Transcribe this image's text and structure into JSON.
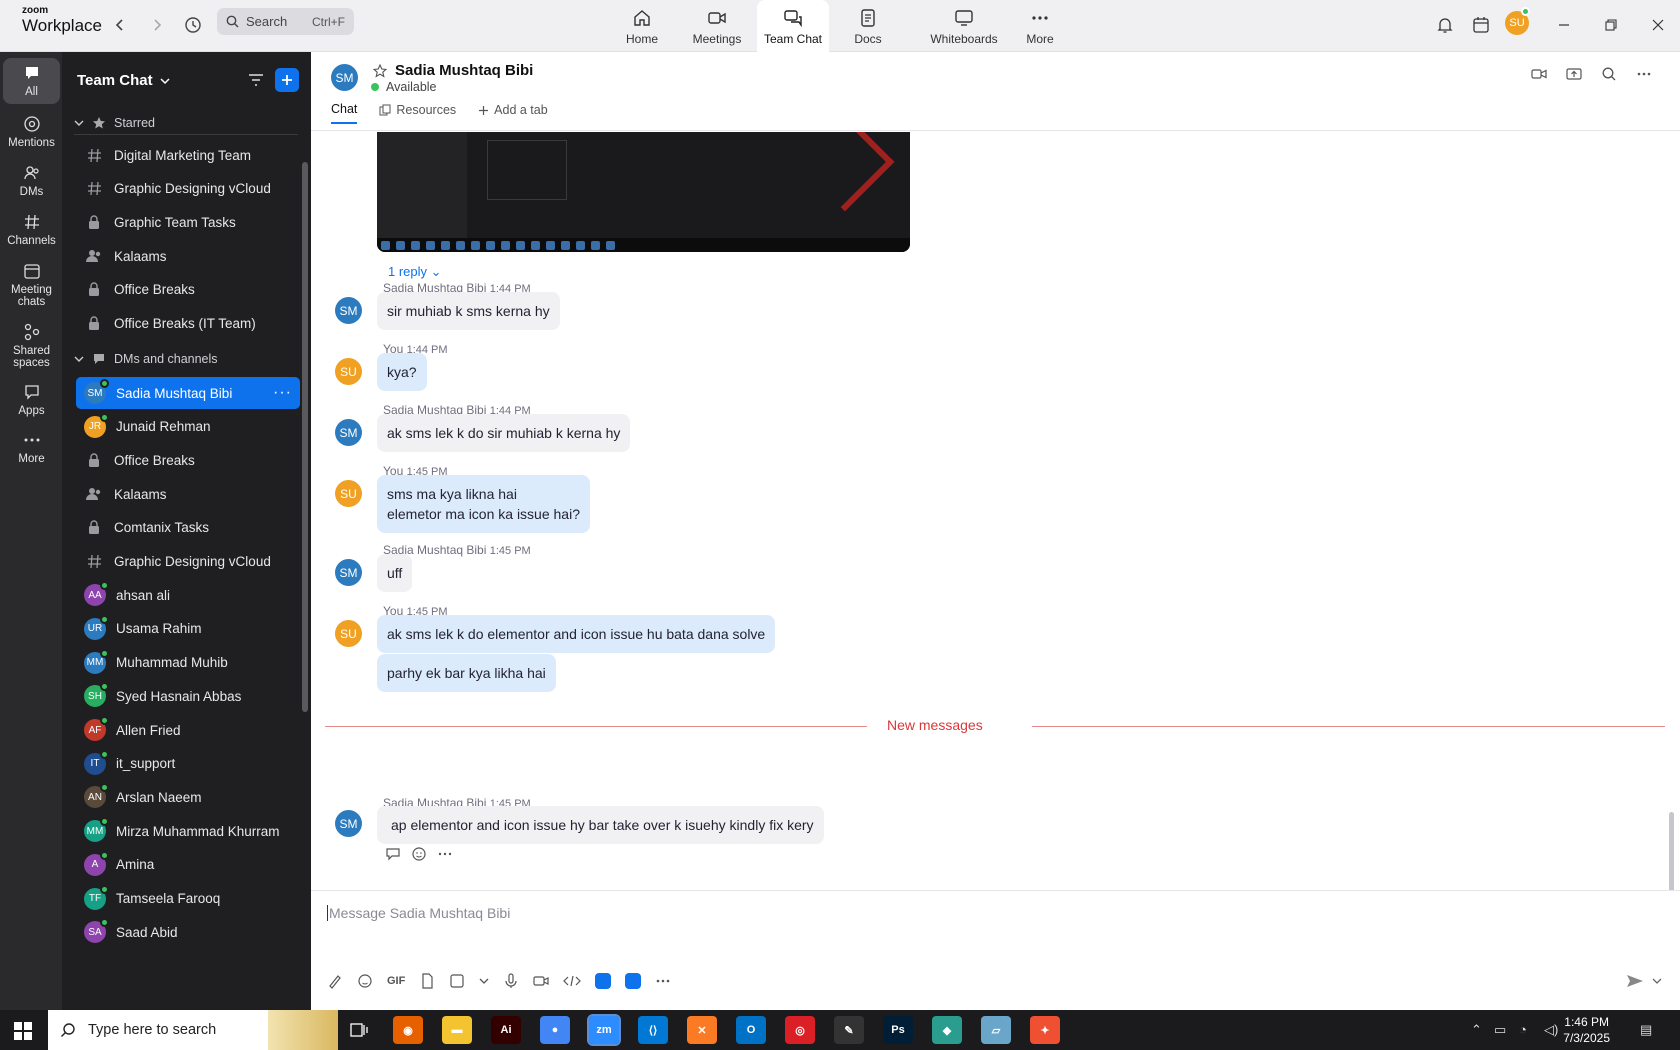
{
  "app": {
    "brand_top": "zoom",
    "brand_bottom": "Workplace"
  },
  "search": {
    "placeholder": "Search",
    "shortcut": "Ctrl+F"
  },
  "nav_tabs": [
    {
      "label": "Home",
      "icon": "home-icon"
    },
    {
      "label": "Meetings",
      "icon": "video-icon"
    },
    {
      "label": "Team Chat",
      "icon": "chat-icon",
      "active": true
    },
    {
      "label": "Docs",
      "icon": "doc-icon"
    },
    {
      "label": "Whiteboards",
      "icon": "whiteboard-icon"
    },
    {
      "label": "More",
      "icon": "more-icon"
    }
  ],
  "user": {
    "initials": "SU"
  },
  "rail": [
    {
      "label": "All",
      "active": true
    },
    {
      "label": "Mentions"
    },
    {
      "label": "DMs"
    },
    {
      "label": "Channels"
    },
    {
      "label": "Meeting chats"
    },
    {
      "label": "Shared spaces"
    },
    {
      "label": "Apps"
    },
    {
      "label": "More"
    }
  ],
  "sidebar": {
    "title": "Team Chat",
    "starred_label": "Starred",
    "starred": [
      {
        "label": "Digital Marketing Team",
        "type": "channel"
      },
      {
        "label": "Graphic Designing vCloud",
        "type": "channel"
      },
      {
        "label": "Graphic Team Tasks",
        "type": "private"
      },
      {
        "label": "Kalaams",
        "type": "group"
      },
      {
        "label": "Office Breaks",
        "type": "private"
      },
      {
        "label": "Office Breaks (IT Team)",
        "type": "private"
      }
    ],
    "dms_label": "DMs and channels",
    "dms": [
      {
        "label": "Sadia Mushtaq Bibi",
        "type": "person",
        "initials": "SM",
        "color": "#2d7bbf",
        "selected": true
      },
      {
        "label": "Junaid Rehman",
        "type": "person",
        "initials": "JR",
        "color": "#f0a022"
      },
      {
        "label": "Office Breaks",
        "type": "private"
      },
      {
        "label": "Kalaams",
        "type": "group"
      },
      {
        "label": "Comtanix Tasks",
        "type": "private"
      },
      {
        "label": "Graphic Designing vCloud",
        "type": "channel"
      },
      {
        "label": "ahsan ali",
        "type": "person",
        "initials": "AA",
        "color": "#8e44ad"
      },
      {
        "label": "Usama Rahim",
        "type": "person",
        "initials": "UR",
        "color": "#2d7bbf"
      },
      {
        "label": "Muhammad Muhib",
        "type": "person",
        "initials": "MM",
        "color": "#2d7bbf"
      },
      {
        "label": "Syed Hasnain Abbas",
        "type": "person",
        "initials": "SH",
        "color": "#27ae60"
      },
      {
        "label": "Allen Fried",
        "type": "person",
        "initials": "AF",
        "color": "#c0392b"
      },
      {
        "label": "it_support",
        "type": "person",
        "initials": "IT",
        "color": "#1f4d8f"
      },
      {
        "label": "Arslan Naeem",
        "type": "person",
        "initials": "AN",
        "color": "#5a4a3a"
      },
      {
        "label": "Mirza Muhammad Khurram",
        "type": "person",
        "initials": "MM",
        "color": "#16a085"
      },
      {
        "label": "Amina",
        "type": "person",
        "initials": "A",
        "color": "#8e44ad"
      },
      {
        "label": "Tamseela Farooq",
        "type": "person",
        "initials": "TF",
        "color": "#16a085"
      },
      {
        "label": "Saad Abid",
        "type": "person",
        "initials": "SA",
        "color": "#8e44ad"
      }
    ]
  },
  "chat": {
    "name": "Sadia Mushtaq Bibi",
    "initials": "SM",
    "status": "Available",
    "tabs": [
      "Chat",
      "Resources",
      "Add a tab"
    ],
    "reply_link": "1 reply",
    "messages": [
      {
        "sender": "Sadia Mushtaq Bibi",
        "time": "1:44 PM",
        "mine": false,
        "texts": [
          "sir muhiab k sms kerna  hy"
        ]
      },
      {
        "sender": "You",
        "time": "1:44 PM",
        "mine": true,
        "texts": [
          "kya?"
        ]
      },
      {
        "sender": "Sadia Mushtaq Bibi",
        "time": "1:44 PM",
        "mine": false,
        "texts": [
          "ak sms lek k do sir muhiab k kerna hy"
        ]
      },
      {
        "sender": "You",
        "time": "1:45 PM",
        "mine": true,
        "texts": [
          "sms ma kya likna hai\nelemetor ma icon ka issue hai?"
        ]
      },
      {
        "sender": "Sadia Mushtaq Bibi",
        "time": "1:45 PM",
        "mine": false,
        "texts": [
          "uff"
        ]
      },
      {
        "sender": "You",
        "time": "1:45 PM",
        "mine": true,
        "texts": [
          "ak sms lek k do elementor and icon issue hu bata dana solve",
          "parhy ek bar kya likha hai"
        ]
      }
    ],
    "new_messages_label": "New messages",
    "last_message": {
      "sender": "Sadia Mushtaq Bibi",
      "time": "1:45 PM",
      "text": "ap elementor and icon issue hy bar take over k isuehy kindly fix kery"
    },
    "composer_placeholder": "Message Sadia Mushtaq Bibi",
    "gif_label": "GIF"
  },
  "taskbar": {
    "search_placeholder": "Type here to search",
    "time": "1:46 PM",
    "date": "7/3/2025",
    "apps": [
      "firefox-icon",
      "file-explorer-icon",
      "illustrator-icon",
      "chrome-icon",
      "zoom-icon",
      "vscode-icon",
      "xampp-icon",
      "outlook-icon",
      "creative-cloud-icon",
      "pen-tool-icon",
      "photoshop-icon",
      "sketch-icon",
      "notepad-icon",
      "git-icon"
    ]
  },
  "colors": {
    "accent": "#0e72ed",
    "me_bubble": "#dcebfb",
    "them_bubble": "#f1f1f4",
    "new_messages": "#d8383a"
  }
}
